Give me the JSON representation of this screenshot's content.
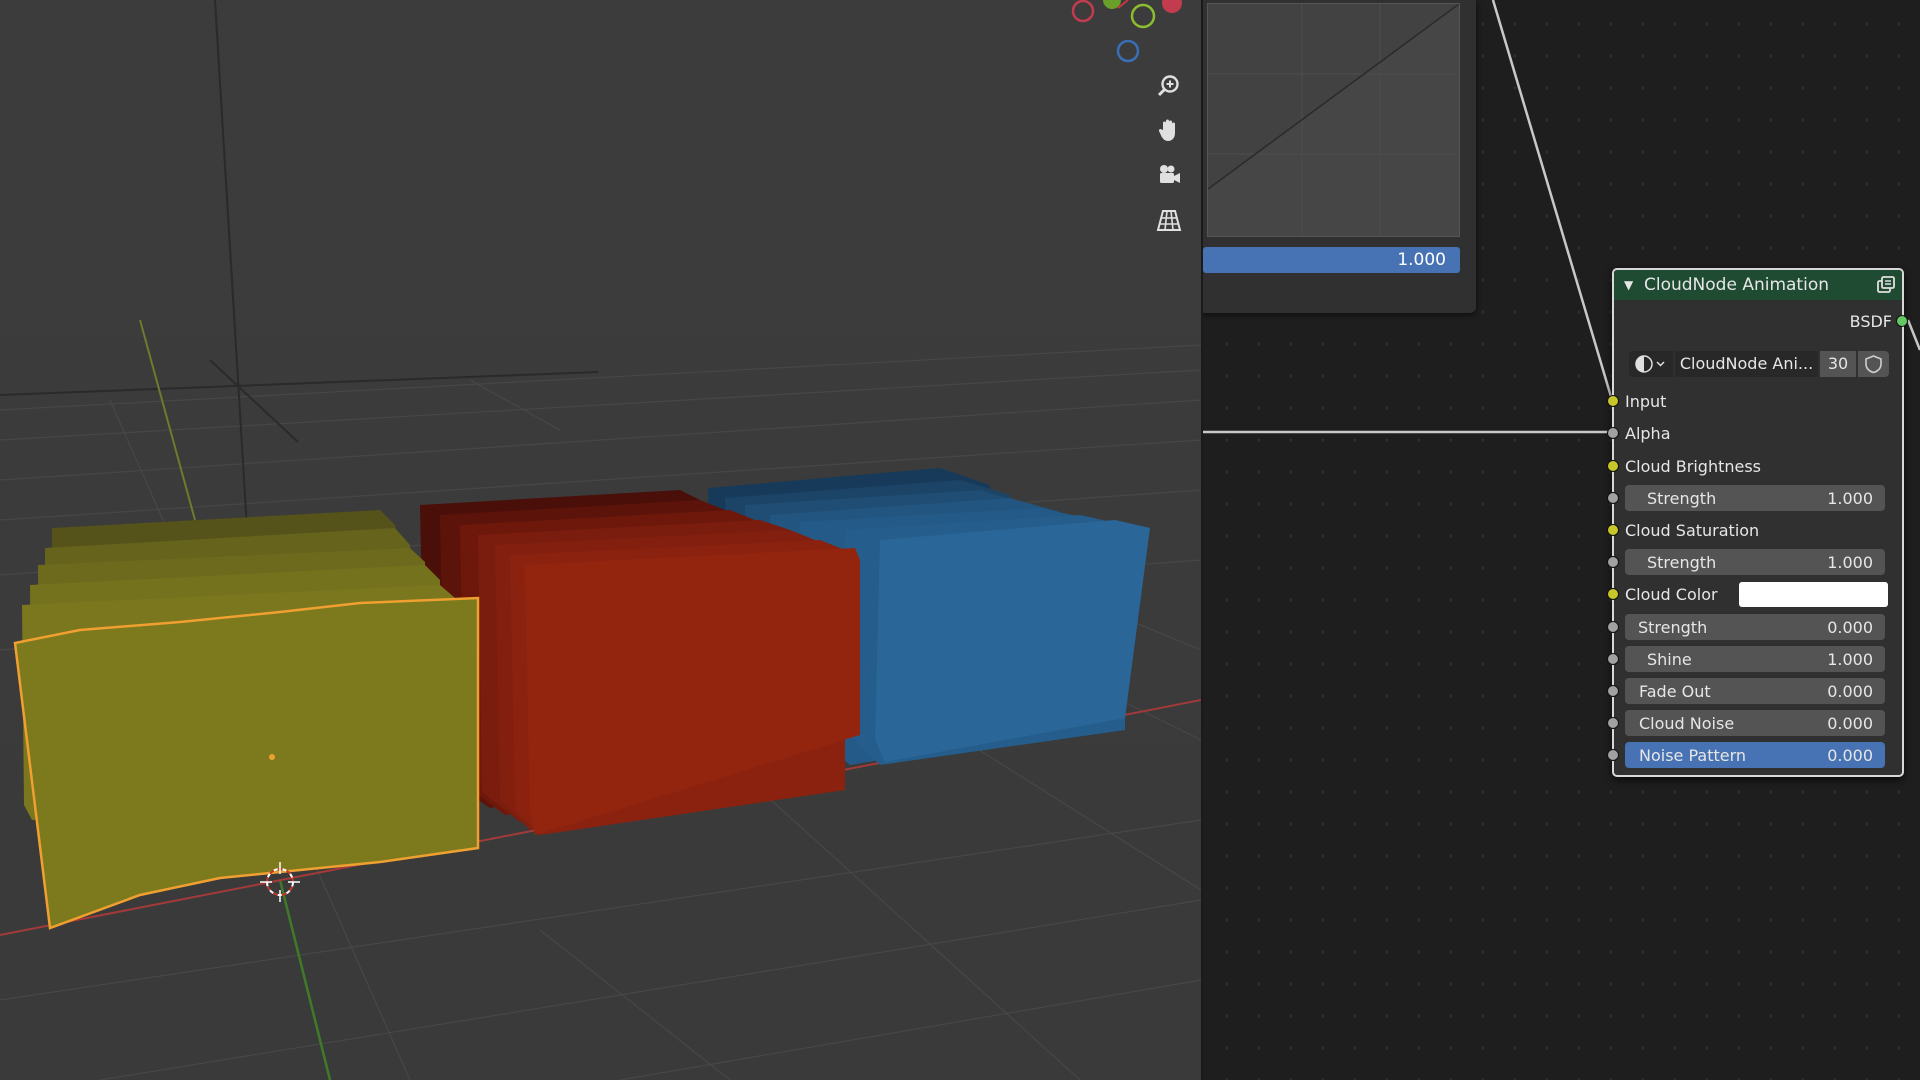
{
  "curve_node": {
    "value": "1.000"
  },
  "node": {
    "title": "CloudNode Animation",
    "output_label": "BSDF",
    "datablock": {
      "name": "CloudNode Ani...",
      "users": "30"
    },
    "inputs": [
      {
        "label": "Input"
      },
      {
        "label": "Alpha"
      },
      {
        "label": "Cloud Brightness"
      },
      {
        "label": "Strength",
        "value": "1.000"
      },
      {
        "label": "Cloud Saturation"
      },
      {
        "label": "Strength",
        "value": "1.000"
      },
      {
        "label": "Cloud Color",
        "color": "#ffffff"
      },
      {
        "label": "Strength",
        "value": "0.000"
      },
      {
        "label": "Shine",
        "value": "1.000"
      },
      {
        "label": "Fade Out",
        "value": "0.000"
      },
      {
        "label": "Cloud Noise",
        "value": "0.000"
      },
      {
        "label": "Noise Pattern",
        "value": "0.000"
      }
    ]
  },
  "colors": {
    "node_header": "#1f4b32",
    "active_field": "#4772b3",
    "selection_outline": "#f0a030",
    "yellow_cards": "#7d7a1e",
    "red_cards": "#8b2210",
    "blue_cards": "#255e8c"
  },
  "viewport": {
    "tools": [
      "zoom-icon",
      "pan-hand-icon",
      "camera-icon",
      "perspective-grid-icon"
    ]
  }
}
